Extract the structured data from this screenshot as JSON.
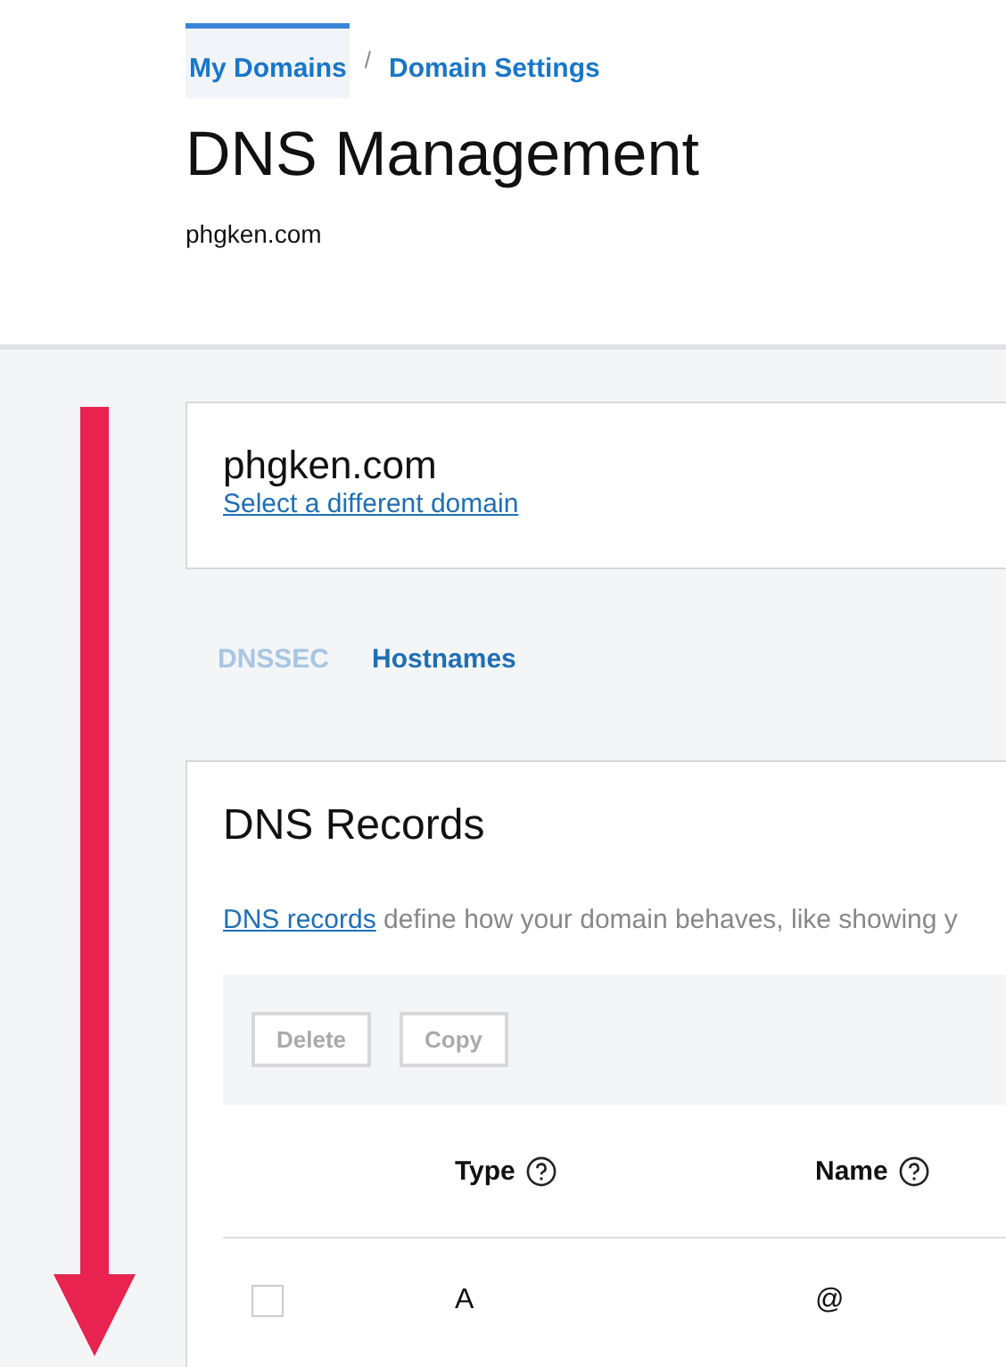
{
  "breadcrumb": [
    {
      "label": "My Domains",
      "selected": true
    },
    {
      "label": "Domain Settings",
      "selected": false
    }
  ],
  "breadcrumb_separator": "/",
  "title": "DNS Management",
  "domain": "phgken.com",
  "domain_card": {
    "domain": "phgken.com",
    "link": "Select a different domain"
  },
  "tabs": [
    {
      "label": "DNSSEC",
      "selected": false
    },
    {
      "label": "Hostnames",
      "selected": true
    }
  ],
  "records": {
    "title": "DNS Records",
    "link": "DNS records",
    "description": " define how your domain behaves, like showing y",
    "buttons": [
      {
        "label": "Delete",
        "disabled": true
      },
      {
        "label": "Copy",
        "disabled": true
      }
    ],
    "columns": [
      {
        "label": "Type",
        "help": true
      },
      {
        "label": "Name",
        "help": true
      }
    ],
    "rows": [
      {
        "checked": false,
        "cells": [
          "A",
          "@"
        ]
      }
    ]
  },
  "annotation": {
    "kind": "arrow"
  }
}
